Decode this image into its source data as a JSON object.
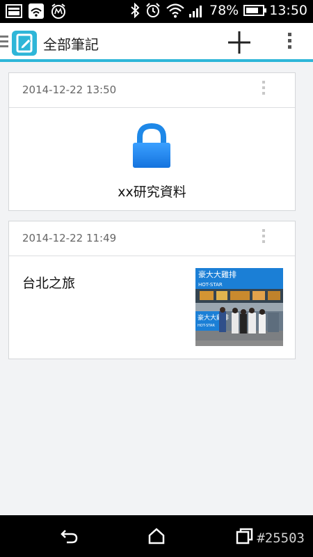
{
  "status_bar": {
    "battery": "78%",
    "battery_level": 0.78,
    "time": "13:50",
    "left_icons": [
      "gallery-notification-icon",
      "wifi-notification-icon",
      "alarm-app-notification-icon"
    ],
    "right_icons": [
      "bluetooth-icon",
      "alarm-clock-icon",
      "wifi-signal-icon",
      "cell-signal-icon",
      "battery-icon"
    ]
  },
  "app_bar": {
    "title": "全部筆記",
    "add_icon": "plus-icon",
    "menu_icon": "overflow-menu-icon"
  },
  "notes": [
    {
      "date": "2014-12-22 13:50",
      "title": "xx研究資料",
      "locked": true,
      "icon": "lock-icon"
    },
    {
      "date": "2014-12-22 11:49",
      "title": "台北之旅",
      "locked": false,
      "thumbnail_text": [
        "豪大大雞排",
        "HOT-STAR",
        "豪大大雞排",
        "HOT-STAR"
      ]
    }
  ],
  "nav_bar": {
    "watermark": "#25503",
    "icons": [
      "back-icon",
      "home-icon",
      "recent-apps-icon"
    ]
  },
  "colors": {
    "accent": "#2eb6d8",
    "lock": "#1e88e8",
    "background": "#f2f3f5"
  }
}
